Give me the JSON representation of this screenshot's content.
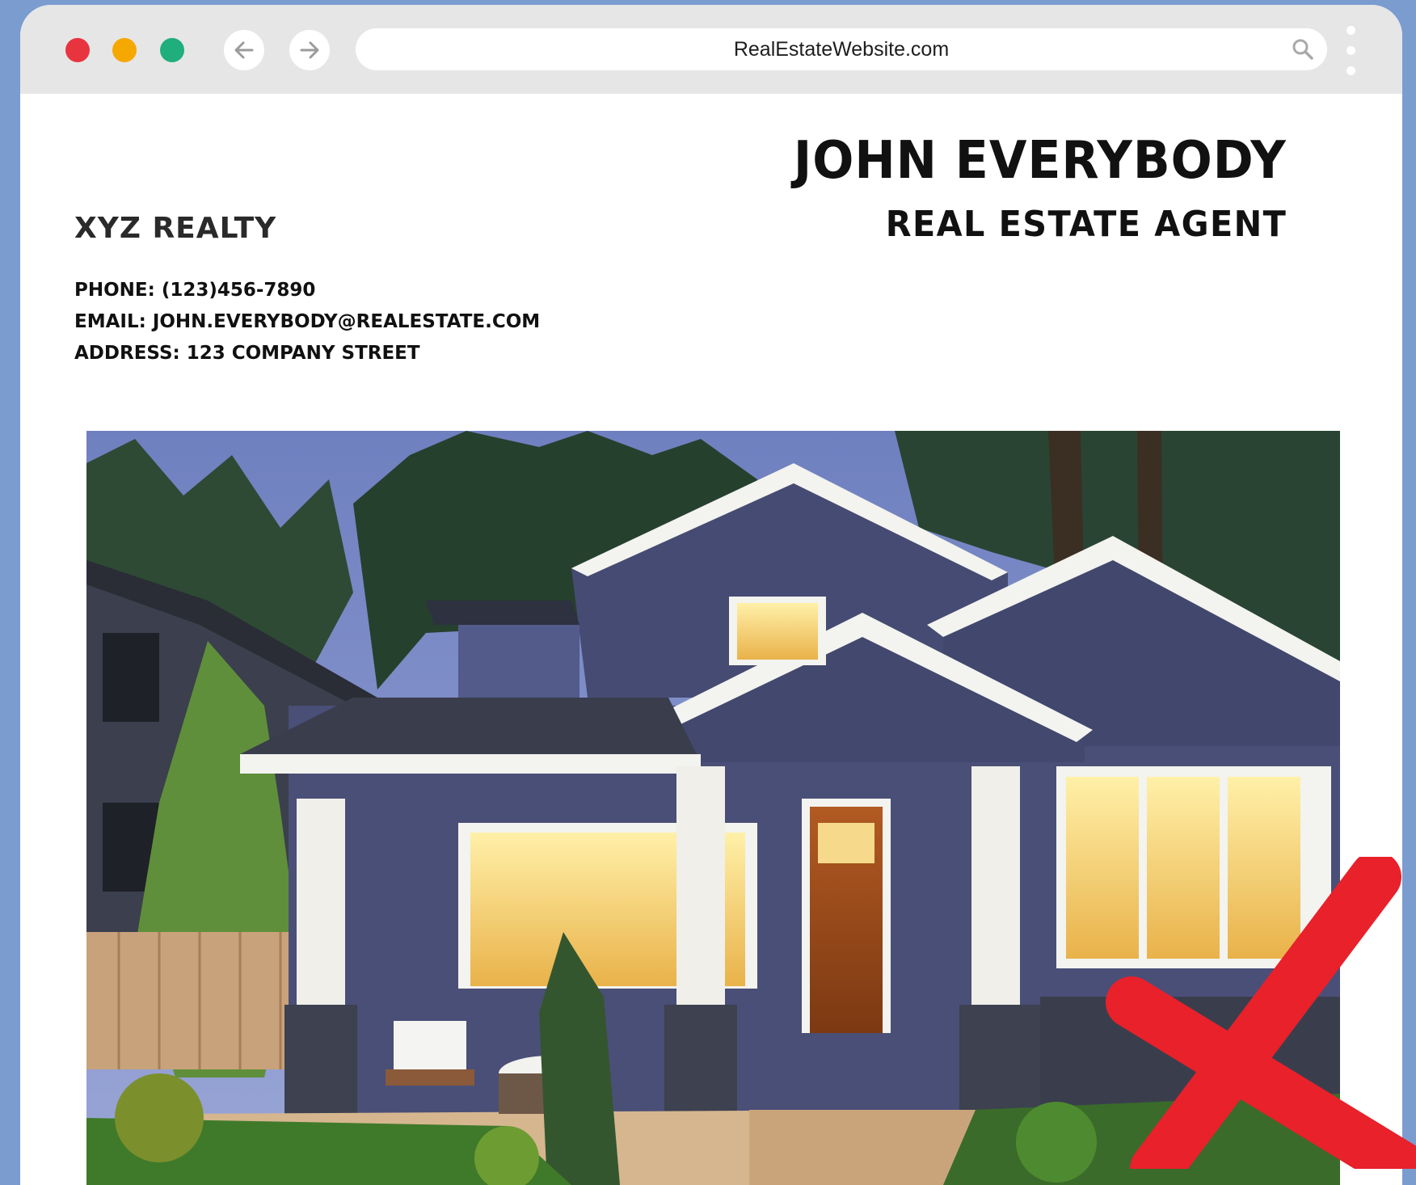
{
  "browser": {
    "url": "RealEstateWebsite.com",
    "icons": {
      "back": "arrow-left-icon",
      "forward": "arrow-right-icon",
      "search": "search-icon",
      "menu": "kebab-menu-icon"
    }
  },
  "page": {
    "agent_name": "JOHN EVERYBODY",
    "agent_title": "REAL ESTATE AGENT",
    "company": "XYZ REALTY",
    "contact": {
      "phone": "PHONE: (123)456-7890",
      "email": "EMAIL: JOHN.EVERYBODY@REALESTATE.COM",
      "address": "ADDRESS: 123 COMPANY STREET"
    }
  },
  "colors": {
    "background": "#7a9ccf",
    "chrome": "#e6e6e7",
    "close": "#e8343f",
    "minimize": "#f5a800",
    "maximize": "#1fae7c",
    "x_mark": "#e8212b"
  }
}
